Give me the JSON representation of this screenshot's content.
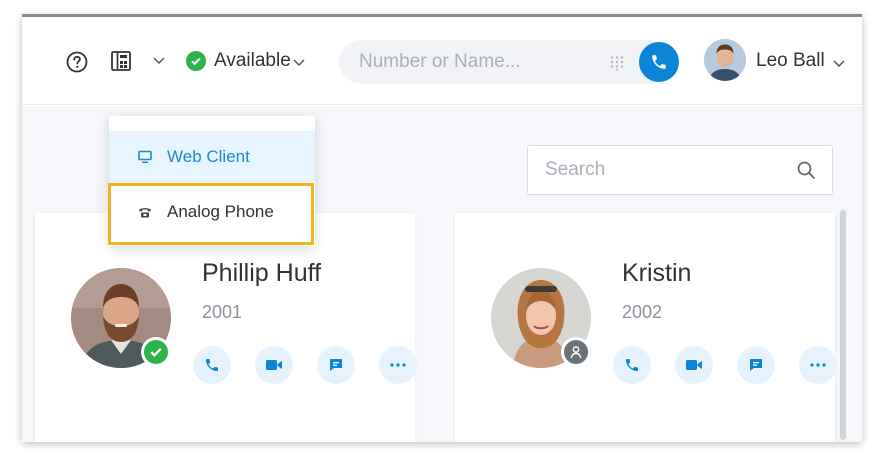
{
  "header": {
    "status_label": "Available",
    "search_placeholder": "Number or Name...",
    "user_name": "Leo Ball"
  },
  "device_menu": {
    "items": [
      {
        "label": "Web Client",
        "icon": "monitor-icon",
        "selected": true
      },
      {
        "label": "Analog Phone",
        "icon": "phone-handset-icon",
        "selected": false
      }
    ],
    "highlighted": "Analog Phone"
  },
  "contact_search": {
    "placeholder": "Search"
  },
  "contacts": [
    {
      "name": "Phillip Huff",
      "ext": "2001",
      "presence": "available"
    },
    {
      "name": "Kristin",
      "ext": "2002",
      "presence": "offline"
    }
  ],
  "colors": {
    "accent": "#0b84d8",
    "available": "#2cb34a",
    "highlight": "#f6b120",
    "menu_active_bg": "#e7f6fe"
  }
}
